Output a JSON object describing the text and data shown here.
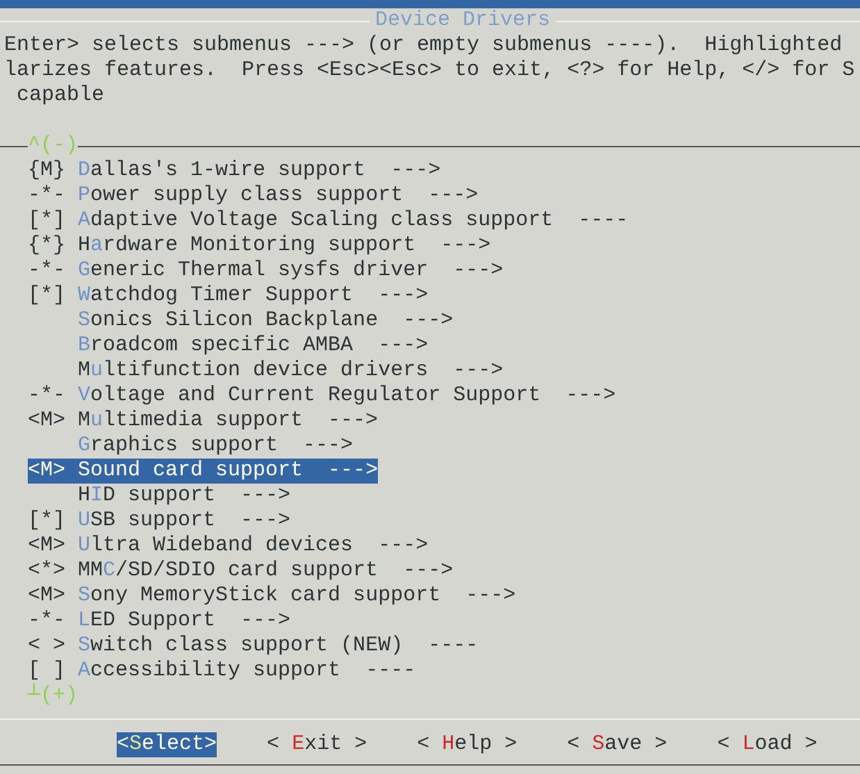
{
  "window": {
    "title": "Device Drivers"
  },
  "help_lines": [
    "Enter> selects submenus ---> (or empty submenus ----).  Highlighted",
    "larizes features.  Press <Esc><Esc> to exit, <?> for Help, </> for S",
    "capable"
  ],
  "scroll_up": "^(-)",
  "items": [
    {
      "prefix": "{M}",
      "key": "D",
      "post": "allas's 1-wire support  --->",
      "selected": false
    },
    {
      "prefix": "-*-",
      "key": "P",
      "post": "ower supply class support  --->",
      "selected": false
    },
    {
      "prefix": "[*]",
      "key": "A",
      "post": "daptive Voltage Scaling class support  ----",
      "selected": false
    },
    {
      "prefix": "{*}",
      "pre": "H",
      "key": "a",
      "post": "rdware Monitoring support  --->",
      "selected": false
    },
    {
      "prefix": "-*-",
      "key": "G",
      "post": "eneric Thermal sysfs driver  --->",
      "selected": false
    },
    {
      "prefix": "[*]",
      "key": "W",
      "post": "atchdog Timer Support  --->",
      "selected": false
    },
    {
      "key": "S",
      "post": "onics Silicon Backplane  --->",
      "selected": false
    },
    {
      "key": "B",
      "post": "roadcom specific AMBA  --->",
      "selected": false
    },
    {
      "pre": "M",
      "key": "u",
      "post": "ltifunction device drivers  --->",
      "selected": false
    },
    {
      "prefix": "-*-",
      "key": "V",
      "post": "oltage and Current Regulator Support  --->",
      "selected": false
    },
    {
      "prefix": "<M>",
      "pre": "M",
      "key": "u",
      "post": "ltimedia support  --->",
      "selected": false
    },
    {
      "key": "G",
      "post": "raphics support  --->",
      "selected": false
    },
    {
      "prefix": "<M>",
      "key": "S",
      "post": "ound card support  --->",
      "selected": true
    },
    {
      "pre": "H",
      "key": "I",
      "post": "D support  --->",
      "selected": false
    },
    {
      "prefix": "[*]",
      "key": "U",
      "post": "SB support  --->",
      "selected": false
    },
    {
      "prefix": "<M>",
      "key": "U",
      "post": "ltra Wideband devices  --->",
      "selected": false
    },
    {
      "prefix": "<*>",
      "pre": "MM",
      "key": "C",
      "post": "/SD/SDIO card support  --->",
      "selected": false
    },
    {
      "prefix": "<M>",
      "key": "S",
      "post": "ony MemoryStick card support  --->",
      "selected": false
    },
    {
      "prefix": "-*-",
      "key": "L",
      "post": "ED Support  --->",
      "selected": false
    },
    {
      "prefix": "< >",
      "key": "S",
      "post": "witch class support (NEW)  ----",
      "selected": false
    },
    {
      "prefix": "[ ]",
      "key": "A",
      "post": "ccessibility support  ----",
      "selected": false
    }
  ],
  "scroll_down": "┴(+)",
  "buttons": [
    {
      "pre": "<",
      "key": "S",
      "post": "elect>",
      "selected": true
    },
    {
      "pre": "< ",
      "key": "E",
      "post": "xit >",
      "selected": false
    },
    {
      "pre": "< ",
      "key": "H",
      "post": "elp >",
      "selected": false
    },
    {
      "pre": "< ",
      "key": "S",
      "post": "ave >",
      "selected": false
    },
    {
      "pre": "< ",
      "key": "L",
      "post": "oad >",
      "selected": false
    }
  ]
}
